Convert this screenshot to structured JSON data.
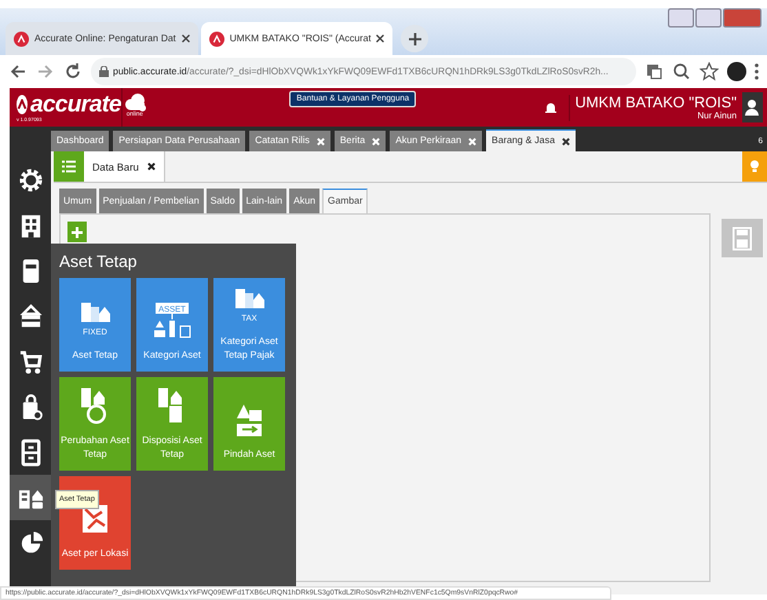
{
  "browser": {
    "tabs": [
      {
        "title": "Accurate Online: Pengaturan Dat",
        "selected": false
      },
      {
        "title": "UMKM BATAKO \"ROIS\" (Accurat",
        "selected": true
      }
    ],
    "address": {
      "host": "public.accurate.id",
      "path": "/accurate/?_dsi=dHlObXVQWk1xYkFWQ09EWFd1TXB6cURQN1hDRk9LS3g0TkdLZlRoS0svR2h..."
    },
    "status_url": "https://public.accurate.id/accurate/?_dsi=dHlObXVQWk1xYkFWQ09EWFd1TXB6cURQN1hDRk9LS3g0TkdLZlRoS0svR2hHb2hVENFc1c5Qm9sVnRlZ0pqcRwo#"
  },
  "header": {
    "logo": "accurate",
    "logo_badge": "online",
    "version": "v 1.0.97093",
    "help_button": "Bantuan & Layanan Pengguna",
    "company": "UMKM BATAKO \"ROIS\"",
    "user": "Nur Ainun"
  },
  "module_tabs": [
    {
      "label": "Dashboard",
      "closable": false,
      "selected": false
    },
    {
      "label": "Persiapan Data Perusahaan",
      "closable": false,
      "selected": false
    },
    {
      "label": "Catatan Rilis",
      "closable": true,
      "selected": false
    },
    {
      "label": "Berita",
      "closable": true,
      "selected": false
    },
    {
      "label": "Akun Perkiraan",
      "closable": true,
      "selected": false
    },
    {
      "label": "Barang & Jasa",
      "closable": true,
      "selected": true
    }
  ],
  "tab_count": "6",
  "sidebar": [
    {
      "kind": "gear",
      "selected": false
    },
    {
      "kind": "building",
      "selected": false
    },
    {
      "kind": "phone",
      "selected": false
    },
    {
      "kind": "wallet",
      "selected": false
    },
    {
      "kind": "cart",
      "selected": false
    },
    {
      "kind": "bag",
      "selected": false
    },
    {
      "kind": "cabinet",
      "selected": false
    },
    {
      "kind": "asset",
      "selected": true
    },
    {
      "kind": "pie",
      "selected": false
    }
  ],
  "tooltip": "Aset Tetap",
  "sub_tab": "Data Baru",
  "form_tabs": [
    {
      "label": "Umum",
      "selected": false
    },
    {
      "label": "Penjualan / Pembelian",
      "selected": false
    },
    {
      "label": "Saldo",
      "selected": false
    },
    {
      "label": "Lain-lain",
      "selected": false
    },
    {
      "label": "Akun",
      "selected": false
    },
    {
      "label": "Gambar",
      "selected": true
    }
  ],
  "flyout": {
    "title": "Aset Tetap",
    "tiles": [
      {
        "label": "Aset Tetap",
        "icon_label": "FIXED",
        "color": "#3b8ede"
      },
      {
        "label": "Kategori Aset",
        "icon_label": "ASSET",
        "color": "#3b8ede"
      },
      {
        "label": "Kategori Aset Tetap Pajak",
        "icon_label": "TAX",
        "color": "#3b8ede"
      },
      {
        "label": "Perubahan Aset Tetap",
        "color": "#5ea81c"
      },
      {
        "label": "Disposisi Aset Tetap",
        "color": "#5ea81c"
      },
      {
        "label": "Pindah Aset",
        "color": "#5ea81c"
      },
      {
        "label": "Aset per Lokasi",
        "color": "#e04330"
      }
    ]
  }
}
